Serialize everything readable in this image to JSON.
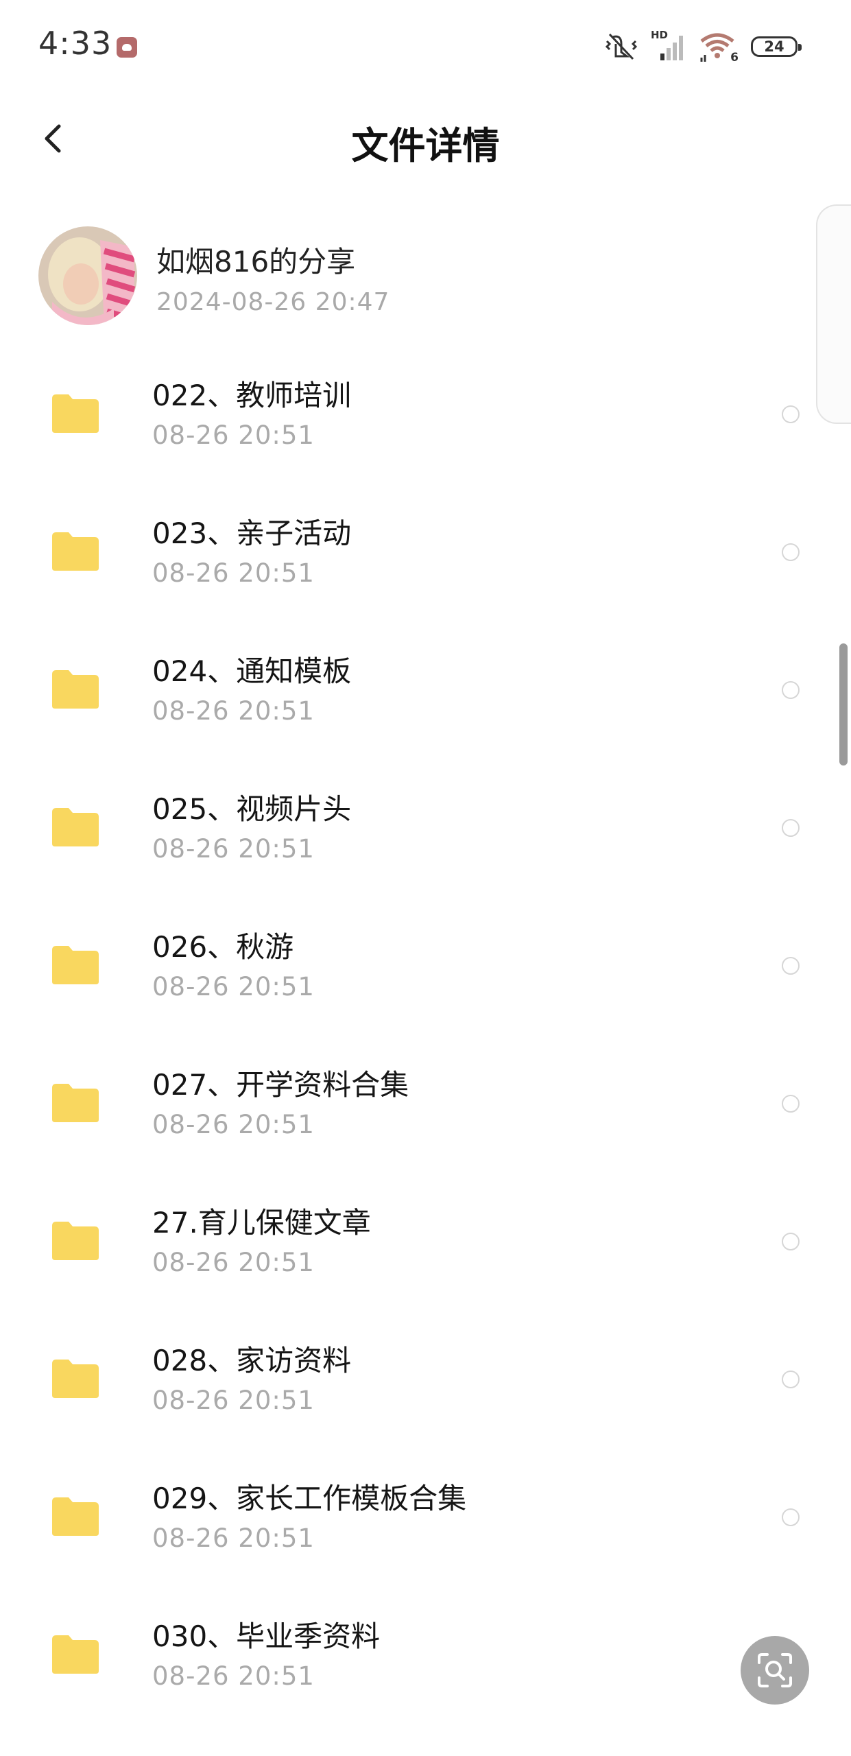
{
  "status_bar": {
    "time": "4:33",
    "notification_icon": "cloud-app-icon",
    "network_label": "HD",
    "wifi_label": "6",
    "battery": "24"
  },
  "header": {
    "title": "文件详情",
    "back_icon": "chevron-left-icon"
  },
  "sharer": {
    "name": "如烟816的分享",
    "datetime": "2024-08-26  20:47"
  },
  "files": [
    {
      "name": "022、教师培训",
      "date": "08-26  20:51"
    },
    {
      "name": "023、亲子活动",
      "date": "08-26  20:51"
    },
    {
      "name": "024、通知模板",
      "date": "08-26  20:51"
    },
    {
      "name": "025、视频片头",
      "date": "08-26  20:51"
    },
    {
      "name": "026、秋游",
      "date": "08-26  20:51"
    },
    {
      "name": "027、开学资料合集",
      "date": "08-26  20:51"
    },
    {
      "name": "27.育儿保健文章",
      "date": "08-26  20:51"
    },
    {
      "name": "028、家访资料",
      "date": "08-26  20:51"
    },
    {
      "name": "029、家长工作模板合集",
      "date": "08-26  20:51"
    },
    {
      "name": "030、毕业季资料",
      "date": "08-26  20:51"
    }
  ],
  "colors": {
    "folder": "#f9d75f",
    "secondary_text": "#aaaaaa",
    "lens_button": "#a8a8a8"
  }
}
